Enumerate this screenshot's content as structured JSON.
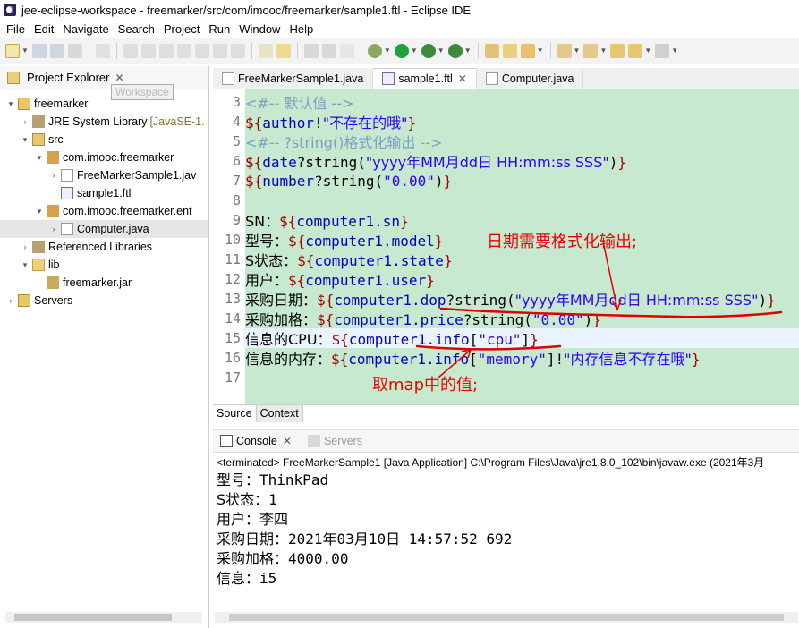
{
  "window": {
    "title": "jee-eclipse-workspace - freemarker/src/com/imooc/freemarker/sample1.ftl - Eclipse IDE"
  },
  "menu": [
    "File",
    "Edit",
    "Navigate",
    "Search",
    "Project",
    "Run",
    "Window",
    "Help"
  ],
  "explorer": {
    "title": "Project Explorer",
    "tooltip": "Workspace",
    "tree": [
      {
        "label": "freemarker",
        "decor": ""
      },
      {
        "label": "JRE System Library",
        "decor": "[JavaSE-1."
      },
      {
        "label": "src",
        "decor": ""
      },
      {
        "label": "com.imooc.freemarker",
        "decor": ""
      },
      {
        "label": "FreeMarkerSample1.jav",
        "decor": ""
      },
      {
        "label": "sample1.ftl",
        "decor": ""
      },
      {
        "label": "com.imooc.freemarker.ent",
        "decor": ""
      },
      {
        "label": "Computer.java",
        "decor": ""
      },
      {
        "label": "Referenced Libraries",
        "decor": ""
      },
      {
        "label": "lib",
        "decor": ""
      },
      {
        "label": "freemarker.jar",
        "decor": ""
      },
      {
        "label": "Servers",
        "decor": ""
      }
    ]
  },
  "editor": {
    "tabs": [
      "FreeMarkerSample1.java",
      "sample1.ftl",
      "Computer.java"
    ],
    "active_tab": "sample1.ftl",
    "line_numbers": [
      "3",
      "4",
      "5",
      "6",
      "7",
      "8",
      "9",
      "10",
      "11",
      "12",
      "13",
      "14",
      "15",
      "16",
      "17"
    ],
    "lines": {
      "l3": "<#-- 默认值 -->",
      "l4_open": "${",
      "l4_var": "author",
      "l4_mid": "!",
      "l4_str": "\"不存在的哦\"",
      "l4_close": "}",
      "l5": "<#-- ?string()格式化输出 -->",
      "l6_open": "${",
      "l6_var": "date",
      "l6_mid": "?string(",
      "l6_str": "\"yyyy年MM月dd日 HH:mm:ss SSS\"",
      "l6_end": ")",
      "l6_close": "}",
      "l7_open": "${",
      "l7_var": "number",
      "l7_mid": "?string(",
      "l7_str": "\"0.00\"",
      "l7_end": ")",
      "l7_close": "}",
      "l9_label": "SN：",
      "l9_open": "${",
      "l9_var": "computer1.sn",
      "l9_close": "}",
      "l10_label": "型号：",
      "l10_open": "${",
      "l10_var": "computer1.model",
      "l10_close": "}",
      "l11_label": "S状态：",
      "l11_open": "${",
      "l11_var": "computer1.state",
      "l11_close": "}",
      "l12_label": "用户：",
      "l12_open": "${",
      "l12_var": "computer1.user",
      "l12_close": "}",
      "l13_label": "采购日期：",
      "l13_open": "${",
      "l13_var": "computer1.dop",
      "l13_mid": "?string(",
      "l13_str": "\"yyyy年MM月dd日 HH:mm:ss SSS\"",
      "l13_end": ")",
      "l13_close": "}",
      "l14_label": "采购加格：",
      "l14_open": "${",
      "l14_var": "computer1.price",
      "l14_mid": "?string(",
      "l14_str": "\"0.00\"",
      "l14_end": ")",
      "l14_close": "}",
      "l15_label": "信息的CPU：",
      "l15_open": "${",
      "l15_var": "computer1.info",
      "l15_mid": "[",
      "l15_str": "\"cpu\"",
      "l15_end": "]",
      "l15_close": "}",
      "l16_label": "信息的内存：",
      "l16_open": "${",
      "l16_var": "computer1.info",
      "l16_mid": "[",
      "l16_str": "\"memory\"",
      "l16_end": "]!",
      "l16_str2": "\"内存信息不存在哦\"",
      "l16_close": "}"
    },
    "annotations": {
      "date_note": "日期需要格式化输出;",
      "map_note": "取map中的值;"
    },
    "annotation_color": "#e00000",
    "bottom_tabs": [
      "Source",
      "Context"
    ]
  },
  "console": {
    "tabs": [
      "Console",
      "Servers"
    ],
    "status": "<terminated> FreeMarkerSample1 [Java Application] C:\\Program Files\\Java\\jre1.8.0_102\\bin\\javaw.exe (2021年3月",
    "lines": [
      {
        "label": "型号：",
        "value": "ThinkPad"
      },
      {
        "label": "S状态：",
        "value": "1"
      },
      {
        "label": "用户：",
        "value": "李四"
      },
      {
        "label": "采购日期：",
        "value": "2021年03月10日 14:57:52 692"
      },
      {
        "label": "采购加格：",
        "value": "4000.00"
      },
      {
        "label": "信息：",
        "value": "i5"
      }
    ]
  },
  "colors": {
    "editor_bg": "#c7e9cf",
    "delimiter": "#a00000",
    "variable": "#0000c0",
    "string": "#2a00ff",
    "comment": "#7f9fbf"
  }
}
